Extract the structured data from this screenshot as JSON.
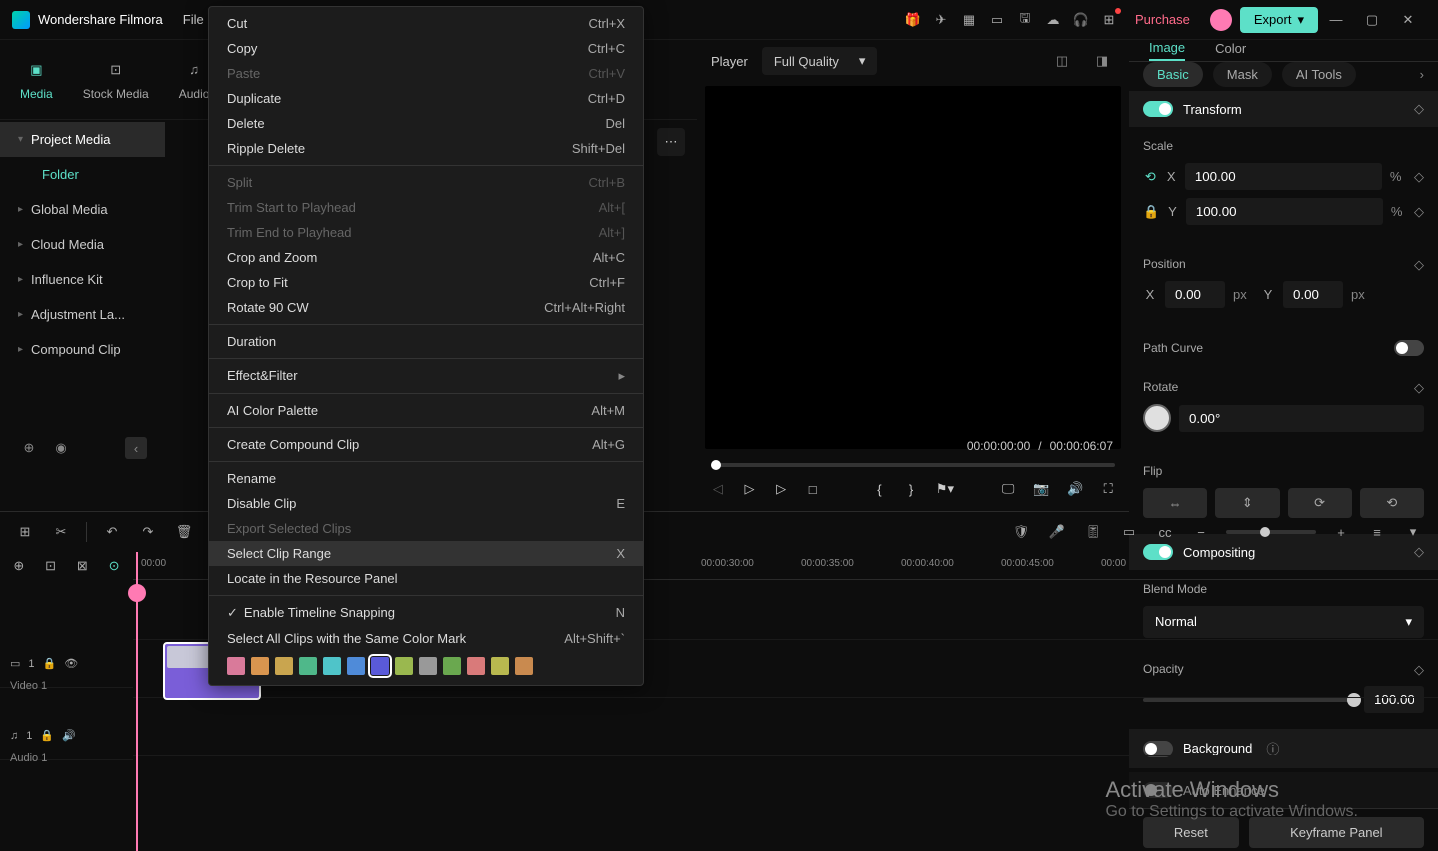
{
  "app": {
    "name": "Wondershare Filmora"
  },
  "titlebar": {
    "menu": [
      "File"
    ],
    "purchase": "Purchase",
    "export": "Export"
  },
  "mediaTabs": [
    "Media",
    "Stock Media",
    "Audio"
  ],
  "sidebar": {
    "items": [
      "Project Media",
      "Global Media",
      "Cloud Media",
      "Influence Kit",
      "Adjustment La...",
      "Compound Clip"
    ],
    "folder": "Folder"
  },
  "player": {
    "label": "Player",
    "quality": "Full Quality",
    "currentTime": "00:00:00:00",
    "duration": "00:00:06:07"
  },
  "propsTabs": [
    "Image",
    "Color"
  ],
  "propsSubtabs": [
    "Basic",
    "Mask",
    "AI Tools"
  ],
  "transform": {
    "title": "Transform",
    "scaleLabel": "Scale",
    "scaleX": "100.00",
    "scaleY": "100.00",
    "positionLabel": "Position",
    "posX": "0.00",
    "posY": "0.00",
    "pathCurve": "Path Curve",
    "rotateLabel": "Rotate",
    "rotate": "0.00°",
    "flipLabel": "Flip"
  },
  "compositing": {
    "title": "Compositing",
    "blendLabel": "Blend Mode",
    "blendMode": "Normal",
    "opacityLabel": "Opacity",
    "opacity": "100.00"
  },
  "background": {
    "title": "Background"
  },
  "autoEnhance": {
    "title": "Auto Enhance"
  },
  "propsFooter": {
    "reset": "Reset",
    "keyframe": "Keyframe Panel"
  },
  "timeline": {
    "ticks": [
      "00:00",
      "00:00:30:00",
      "00:00:35:00",
      "00:00:40:00",
      "00:00:45:00",
      "00:00"
    ],
    "video1": "Video 1",
    "audio1": "Audio 1"
  },
  "contextMenu": {
    "items": [
      {
        "label": "Cut",
        "shortcut": "Ctrl+X"
      },
      {
        "label": "Copy",
        "shortcut": "Ctrl+C"
      },
      {
        "label": "Paste",
        "shortcut": "Ctrl+V",
        "disabled": true
      },
      {
        "label": "Duplicate",
        "shortcut": "Ctrl+D"
      },
      {
        "label": "Delete",
        "shortcut": "Del"
      },
      {
        "label": "Ripple Delete",
        "shortcut": "Shift+Del"
      },
      {
        "sep": true
      },
      {
        "label": "Split",
        "shortcut": "Ctrl+B",
        "disabled": true
      },
      {
        "label": "Trim Start to Playhead",
        "shortcut": "Alt+[",
        "disabled": true
      },
      {
        "label": "Trim End to Playhead",
        "shortcut": "Alt+]",
        "disabled": true
      },
      {
        "label": "Crop and Zoom",
        "shortcut": "Alt+C"
      },
      {
        "label": "Crop to Fit",
        "shortcut": "Ctrl+F"
      },
      {
        "label": "Rotate 90 CW",
        "shortcut": "Ctrl+Alt+Right"
      },
      {
        "sep": true
      },
      {
        "label": "Duration"
      },
      {
        "sep": true
      },
      {
        "label": "Effect&Filter",
        "submenu": true
      },
      {
        "sep": true
      },
      {
        "label": "AI Color Palette",
        "shortcut": "Alt+M"
      },
      {
        "sep": true
      },
      {
        "label": "Create Compound Clip",
        "shortcut": "Alt+G"
      },
      {
        "sep": true
      },
      {
        "label": "Rename"
      },
      {
        "label": "Disable Clip",
        "shortcut": "E"
      },
      {
        "label": "Export Selected Clips",
        "disabled": true
      },
      {
        "label": "Select Clip Range",
        "shortcut": "X",
        "highlighted": true
      },
      {
        "label": "Locate in the Resource Panel"
      },
      {
        "sep": true
      },
      {
        "label": "Enable Timeline Snapping",
        "shortcut": "N",
        "checked": true
      },
      {
        "label": "Select All Clips with the Same Color Mark",
        "shortcut": "Alt+Shift+`"
      }
    ],
    "colors": [
      "#d97a9a",
      "#d9954f",
      "#c9a54f",
      "#4fb88a",
      "#4fc4c9",
      "#4f8bd9",
      "#5a5ad9",
      "#9ab84f",
      "#999999",
      "#6aa84f",
      "#d97a7a",
      "#b8b84f",
      "#c98a4f"
    ]
  },
  "watermark": {
    "title": "Activate Windows",
    "sub": "Go to Settings to activate Windows."
  }
}
